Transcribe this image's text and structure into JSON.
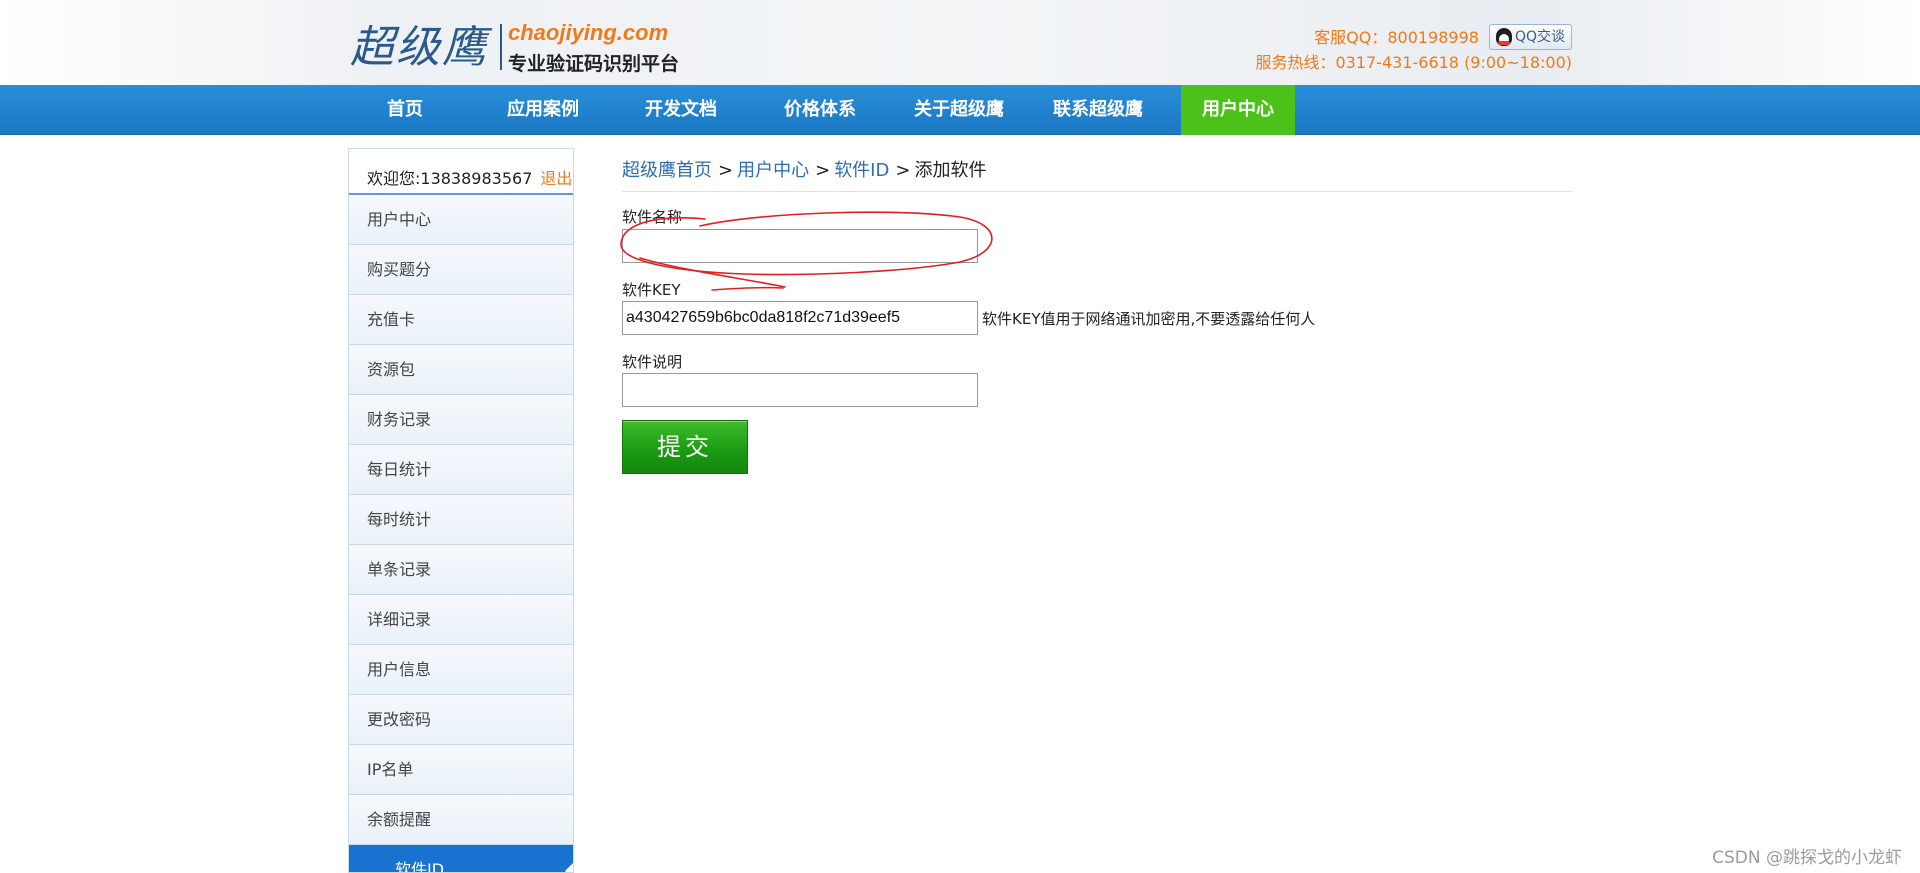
{
  "header": {
    "logo_cn": "超级鹰",
    "logo_en": "chaojiying.com",
    "logo_sub": "专业验证码识别平台",
    "qq_label": "客服QQ：800198998",
    "qq_button": "QQ交谈",
    "hotline": "服务热线：0317-431-6618 (9:00~18:00)"
  },
  "nav": {
    "items": [
      "首页",
      "应用案例",
      "开发文档",
      "价格体系",
      "关于超级鹰",
      "联系超级鹰",
      "用户中心"
    ],
    "active": "用户中心"
  },
  "sidebar": {
    "welcome": "欢迎您:13838983567",
    "logout": "退出",
    "items": [
      "用户中心",
      "购买题分",
      "充值卡",
      "资源包",
      "财务记录",
      "每日统计",
      "每时统计",
      "单条记录",
      "详细记录",
      "用户信息",
      "更改密码",
      "IP名单",
      "余额提醒",
      "软件ID"
    ],
    "active": "软件ID"
  },
  "breadcrumb": {
    "home": "超级鹰首页",
    "user_center": "用户中心",
    "software_id": "软件ID",
    "current": "添加软件",
    "sep": ">"
  },
  "form": {
    "name_label": "软件名称",
    "name_value": "",
    "key_label": "软件KEY",
    "key_value": "a430427659b6bc0da818f2c71d39eef5",
    "key_hint": "软件KEY值用于网络通讯加密用,不要透露给任何人",
    "desc_label": "软件说明",
    "desc_value": "",
    "submit": "提交"
  },
  "colors": {
    "nav_blue": "#1a77c4",
    "nav_active_green": "#4cc11a",
    "accent_orange": "#f07a1a",
    "link_blue": "#2d6db5",
    "submit_green": "#199a12",
    "annotation_red": "#e02020"
  },
  "watermark": "CSDN @跳探戈的小龙虾"
}
